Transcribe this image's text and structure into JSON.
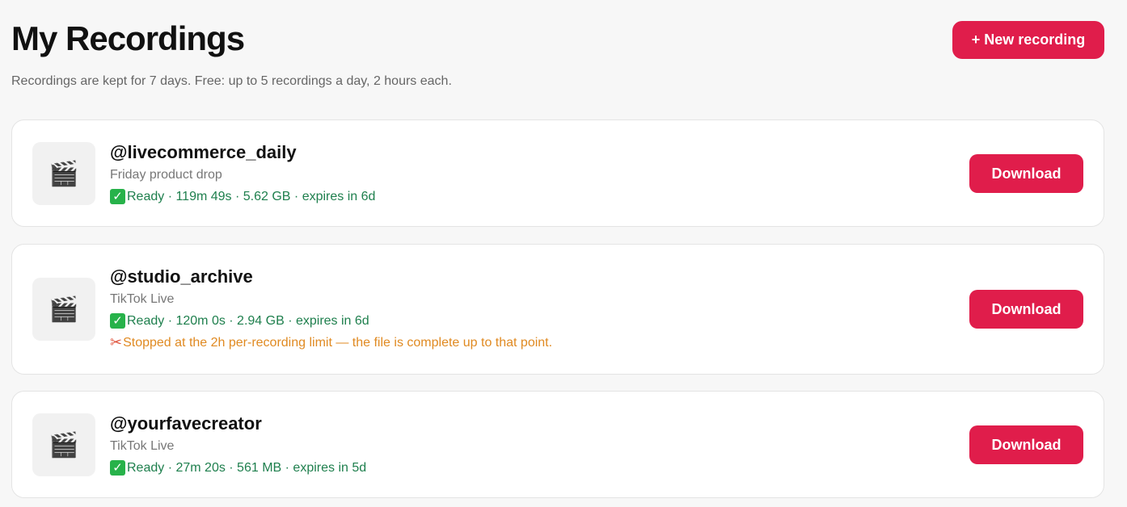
{
  "header": {
    "title": "My Recordings",
    "subtitle": "Recordings are kept for 7 days. Free: up to 5 recordings a day, 2 hours each.",
    "new_button_label": "+ New recording"
  },
  "recordings": [
    {
      "thumb_icon": "🎬",
      "handle": "@livecommerce_daily",
      "caption": "Friday product drop",
      "status_icon": "✓",
      "status": "Ready · 119m 49s · 5.62 GB · expires in 6d",
      "download_label": "Download"
    },
    {
      "thumb_icon": "🎬",
      "handle": "@studio_archive",
      "caption": "TikTok Live",
      "status_icon": "✓",
      "status": "Ready · 120m 0s · 2.94 GB · expires in 6d",
      "warning_icon": "✂",
      "warning": "Stopped at the 2h per-recording limit — the file is complete up to that point.",
      "download_label": "Download"
    },
    {
      "thumb_icon": "🎬",
      "handle": "@yourfavecreator",
      "caption": "TikTok Live",
      "status_icon": "✓",
      "status": "Ready · 27m 20s · 561 MB · expires in 5d",
      "download_label": "Download"
    }
  ],
  "colors": {
    "accent": "#e01d4b",
    "status_ok": "#1e7f4d",
    "warning": "#e08a22",
    "background": "#f7f7f7"
  }
}
